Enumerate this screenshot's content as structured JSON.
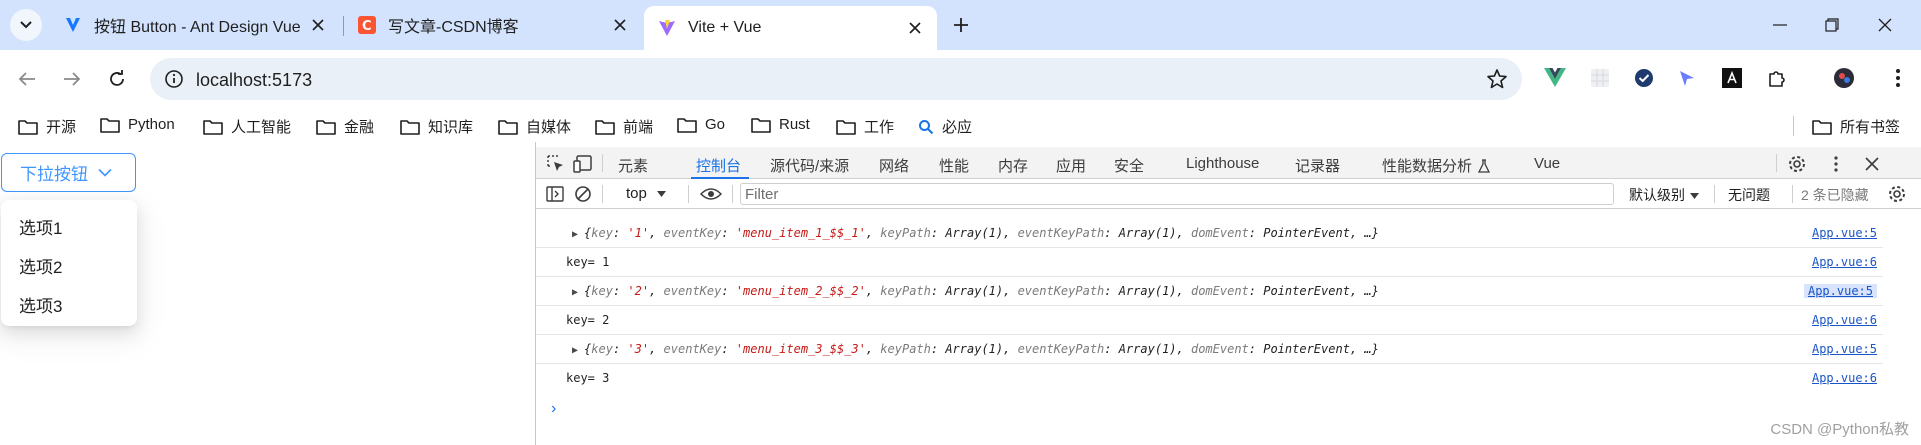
{
  "browser": {
    "tabs": [
      {
        "title": "按钮 Button - Ant Design Vue",
        "icon": "antdv-logo-icon",
        "active": false
      },
      {
        "title": "写文章-CSDN博客",
        "icon": "csdn-logo-icon",
        "active": false
      },
      {
        "title": "Vite + Vue",
        "icon": "vite-logo-icon",
        "active": true
      }
    ],
    "url": "localhost:5173",
    "bookmarks": [
      "开源",
      "Python",
      "人工智能",
      "金融",
      "知识库",
      "自媒体",
      "前端",
      "Go",
      "Rust",
      "工作",
      "必应"
    ],
    "all_bookmarks": "所有书签",
    "colors": {
      "tabstrip": "#d3e3fd",
      "omnibox": "#eaf0f7"
    }
  },
  "page": {
    "dropdown_label": "下拉按钮",
    "menu_items": [
      "选项1",
      "选项2",
      "选项3"
    ],
    "accent": "#4096ff"
  },
  "devtools": {
    "tabs": [
      "元素",
      "控制台",
      "源代码/来源",
      "网络",
      "性能",
      "内存",
      "应用",
      "安全",
      "Lighthouse",
      "记录器",
      "性能数据分析",
      "Vue"
    ],
    "active_tab": "控制台",
    "context": "top",
    "filter_placeholder": "Filter",
    "levels": "默认级别",
    "issues": "无问题",
    "hidden": "2 条已隐藏",
    "logs": [
      {
        "type": "object",
        "key": "'1'",
        "eventKey": "'menu_item_1_$$_1'",
        "keyPath": "Array(1)",
        "eventKeyPath": "Array(1)",
        "domEvent": "PointerEvent",
        "source": "App.vue:5"
      },
      {
        "type": "text",
        "text": "key= 1",
        "source": "App.vue:6"
      },
      {
        "type": "object",
        "key": "'2'",
        "eventKey": "'menu_item_2_$$_2'",
        "keyPath": "Array(1)",
        "eventKeyPath": "Array(1)",
        "domEvent": "PointerEvent",
        "source": "App.vue:5"
      },
      {
        "type": "text",
        "text": "key= 2",
        "source": "App.vue:6"
      },
      {
        "type": "object",
        "key": "'3'",
        "eventKey": "'menu_item_3_$$_3'",
        "keyPath": "Array(1)",
        "eventKeyPath": "Array(1)",
        "domEvent": "PointerEvent",
        "source": "App.vue:5"
      },
      {
        "type": "text",
        "text": "key= 3",
        "source": "App.vue:6"
      }
    ],
    "labels": {
      "key": "key",
      "eventKey": "eventKey",
      "keyPath": "keyPath",
      "eventKeyPath": "eventKeyPath",
      "domEvent": "domEvent",
      "ellipsis": "…"
    }
  },
  "watermark": "CSDN @Python私教"
}
